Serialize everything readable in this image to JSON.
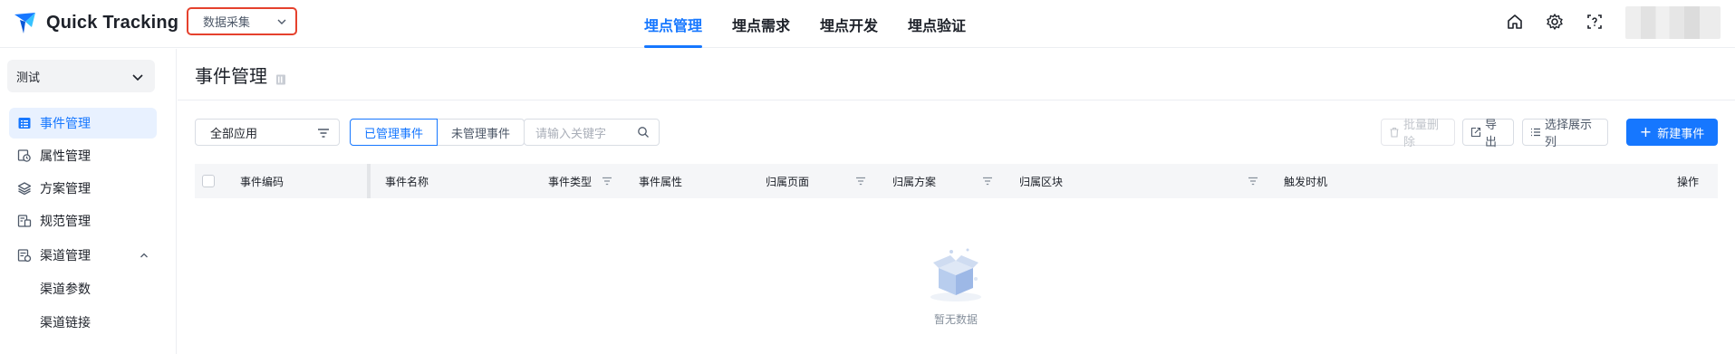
{
  "app": {
    "name": "Quick Tracking",
    "module_select": "数据采集"
  },
  "topnav": {
    "items": [
      {
        "label": "埋点管理",
        "active": true
      },
      {
        "label": "埋点需求",
        "active": false
      },
      {
        "label": "埋点开发",
        "active": false
      },
      {
        "label": "埋点验证",
        "active": false
      }
    ]
  },
  "header_icons": [
    "home-icon",
    "settings-icon",
    "help-icon"
  ],
  "sidebar": {
    "project": "测试",
    "items": [
      {
        "label": "事件管理",
        "icon": "event-list-icon",
        "active": true
      },
      {
        "label": "属性管理",
        "icon": "property-icon",
        "active": false
      },
      {
        "label": "方案管理",
        "icon": "layers-icon",
        "active": false
      },
      {
        "label": "规范管理",
        "icon": "spec-icon",
        "active": false
      },
      {
        "label": "渠道管理",
        "icon": "channel-icon",
        "active": false,
        "expanded": true
      }
    ],
    "sub_items": [
      "渠道参数",
      "渠道链接"
    ]
  },
  "main": {
    "title": "事件管理",
    "filter_app": "全部应用",
    "segments": [
      "已管理事件",
      "未管理事件"
    ],
    "search_placeholder": "请输入关键字",
    "buttons": {
      "batch_delete": "批量删除",
      "export": "导出",
      "choose_columns": "选择展示列",
      "new_event": "新建事件"
    },
    "columns": [
      "事件编码",
      "事件名称",
      "事件类型",
      "事件属性",
      "归属页面",
      "归属方案",
      "归属区块",
      "触发时机",
      "操作"
    ],
    "empty_text": "暂无数据"
  },
  "colors": {
    "accent": "#1677ff",
    "highlight_border": "#e5412d"
  }
}
